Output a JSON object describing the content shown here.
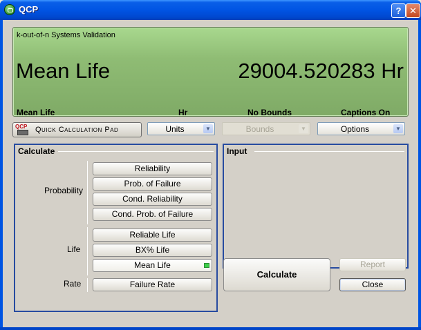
{
  "window": {
    "title": "QCP",
    "help_label": "?",
    "close_label": "✕"
  },
  "display": {
    "caption": "k-out-of-n Systems Validation",
    "label": "Mean Life",
    "value": "29004.520283 Hr",
    "status": [
      "Mean Life",
      "Hr",
      "No Bounds",
      "Captions On"
    ]
  },
  "toolbar": {
    "pad_logo": "QCP",
    "pad_label": "Quick Calculation Pad",
    "units_label": "Units",
    "bounds_label": "Bounds",
    "options_label": "Options"
  },
  "calculate": {
    "title": "Calculate",
    "probability_label": "Probability",
    "life_label": "Life",
    "rate_label": "Rate",
    "probability_items": [
      "Reliability",
      "Prob. of Failure",
      "Cond. Reliability",
      "Cond. Prob. of Failure"
    ],
    "life_items": [
      "Reliable Life",
      "BX% Life",
      "Mean Life"
    ],
    "rate_items": [
      "Failure Rate"
    ],
    "selected": "Mean Life"
  },
  "input": {
    "title": "Input"
  },
  "actions": {
    "calculate_label": "Calculate",
    "report_label": "Report",
    "close_label": "Close"
  },
  "colors": {
    "lcd_green": "#8fbc74",
    "frame_blue": "#274ba0",
    "titlebar_blue": "#0054e3",
    "selected_marker": "#3fcf4a"
  }
}
